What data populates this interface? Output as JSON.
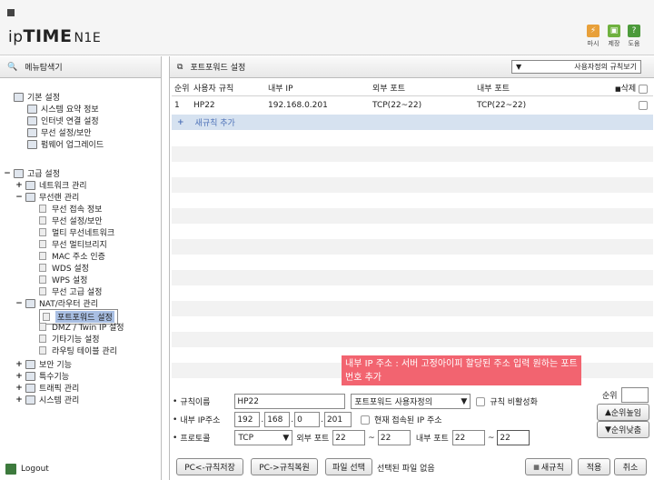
{
  "header": {
    "brand_prefix": "ip",
    "brand_main": "TIME",
    "brand_model": "N1E",
    "buttons": [
      {
        "label": "마시",
        "color": "#e8a03a",
        "icon": "bolt-icon"
      },
      {
        "label": "제장",
        "color": "#6fb13f",
        "icon": "save-icon"
      },
      {
        "label": "도움",
        "color": "#4c9a3b",
        "icon": "help-icon"
      }
    ]
  },
  "sidebar": {
    "title": "메뉴탐색기",
    "groups": {
      "basic": "기본 설정",
      "advanced": "고급 설정"
    },
    "basic_items": [
      "시스템 요약 정보",
      "인터넷 연결 설정",
      "무선 설정/보안",
      "펌웨어 업그레이드"
    ],
    "advanced_items": {
      "network": "네트워크 관리",
      "wireless": "무선랜 관리",
      "wireless_sub": [
        "무선 접속 정보",
        "무선 설정/보안",
        "멀티 무선네트워크",
        "무선 멀티브리지",
        "MAC 주소 인증",
        "WDS 설정",
        "WPS 설정",
        "무선 고급 설정"
      ],
      "nat": "NAT/라우터 관리",
      "nat_sub": [
        "포트포워드 설정",
        "DMZ / Twin IP 설정",
        "기타기능 설정",
        "라우팅 테이블 관리"
      ],
      "security": "보안 기능",
      "special": "특수기능",
      "traffic": "트래픽 관리",
      "system": "시스템 관리"
    },
    "logout": "Logout"
  },
  "main": {
    "title": "포트포워드 설정",
    "view_select": "사용자정의 규칙보기",
    "columns": [
      "순위",
      "사용자 규칙",
      "내부 IP",
      "외부 포트",
      "내부 포트",
      "삭제"
    ],
    "rows": [
      {
        "rank": "1",
        "name": "HP22",
        "ip": "192.168.0.201",
        "ext_port": "TCP(22~22)",
        "int_port": "TCP(22~22)"
      }
    ],
    "add_rule": "새규칙 추가",
    "tooltip": "내부 IP 주소 : 서버 고정아이피 할당된 주소 입력 원하는 포트 번호 추가"
  },
  "form": {
    "rule_name_label": "규칙이름",
    "rule_name": "HP22",
    "rule_type": "포트포워드 사용자정의",
    "disable_label": "규칙 비활성화",
    "ip_label": "내부 IP주소",
    "ip": [
      "192",
      "168",
      "0",
      "201"
    ],
    "current_ip_label": "현재 접속된 IP 주소",
    "protocol_label": "프로토콜",
    "protocol": "TCP",
    "ext_port_label": "외부 포트",
    "ext_port_from": "22",
    "ext_port_to": "22",
    "int_port_label": "내부 포트",
    "int_port_from": "22",
    "int_port_to": "22",
    "tilde": "~",
    "rank_label": "순위",
    "rank_up": "순위높임",
    "rank_down": "순위낮춤",
    "btn_save_pc": "PC<-규칙저장",
    "btn_restore_pc": "PC->규칙복원",
    "btn_file_select": "파일 선택",
    "file_status": "선택된 파일 없음",
    "btn_new": "새규칙",
    "btn_apply": "적용",
    "btn_cancel": "취소"
  }
}
